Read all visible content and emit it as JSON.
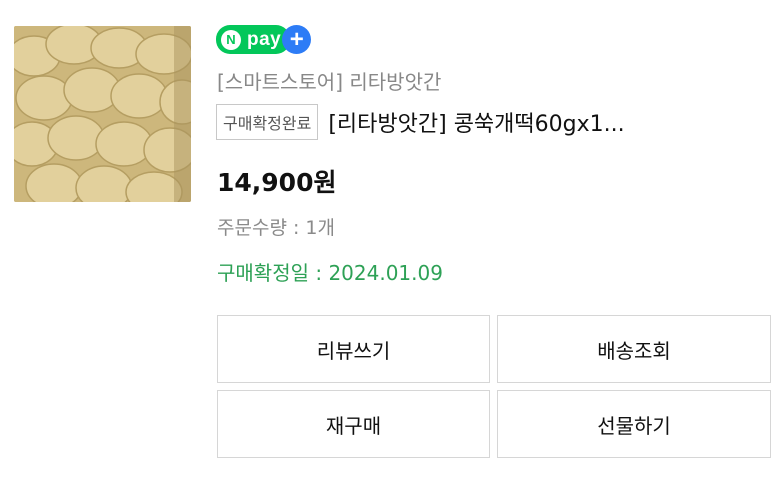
{
  "product": {
    "image_alt": "콩쑥개떡 product photo",
    "pay_badge": {
      "n": "N",
      "text": "pay",
      "plus": "+"
    },
    "store_name": "[스마트스토어] 리타방앗간",
    "status_badge": "구매확정완료",
    "title": "[리타방앗간] 콩쑥개떡60gx1...",
    "price": "14,900원",
    "quantity": "주문수량 : 1개",
    "confirm_date": "구매확정일 : 2024.01.09"
  },
  "actions": {
    "review": "리뷰쓰기",
    "tracking": "배송조회",
    "rebuy": "재구매",
    "gift": "선물하기"
  },
  "colors": {
    "npay_green": "#03c75a",
    "npay_plus_blue": "#2d7cf6",
    "confirm_green": "#2ea156",
    "muted_gray": "#888888"
  }
}
